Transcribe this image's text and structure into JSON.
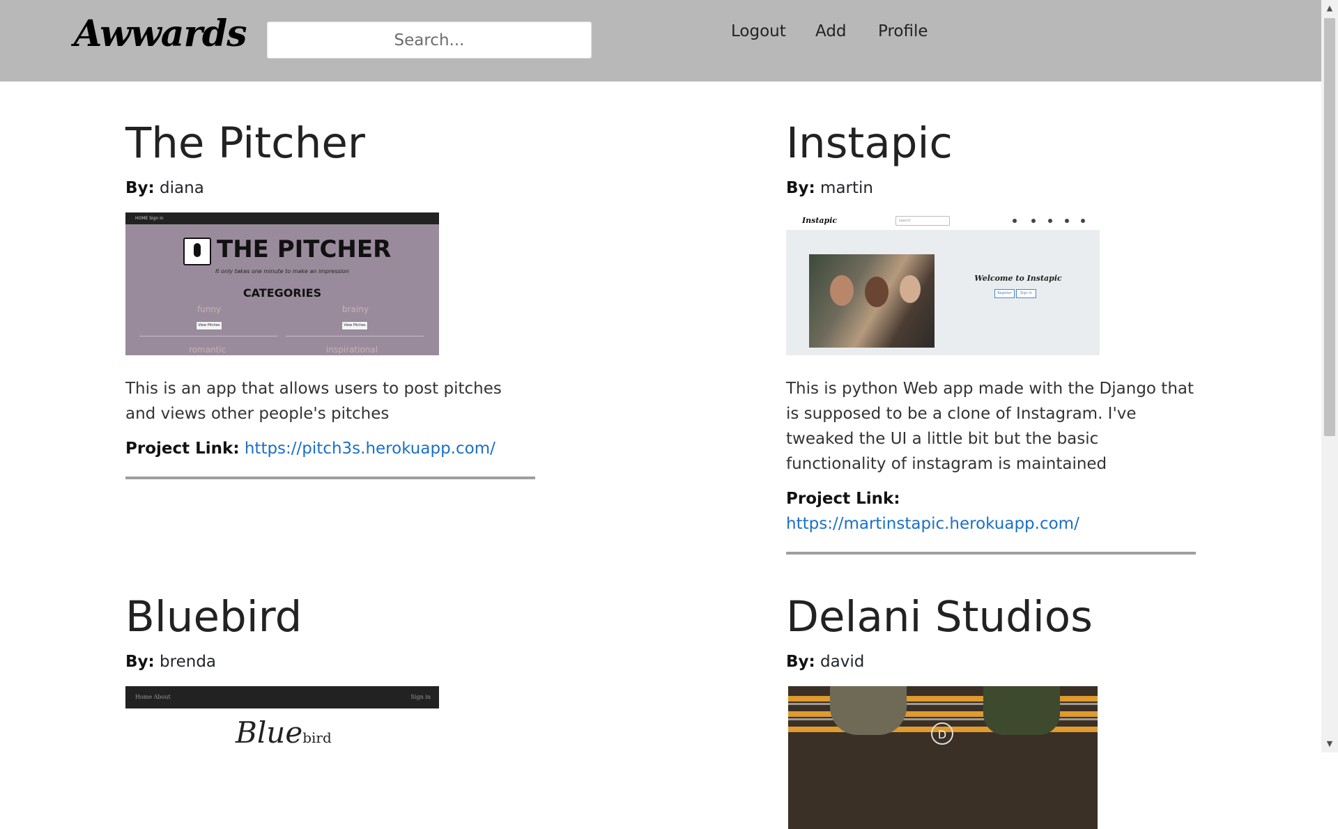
{
  "navbar": {
    "brand": "Awwards",
    "search_placeholder": "Search...",
    "links": [
      "Logout",
      "Add",
      "Profile"
    ]
  },
  "labels": {
    "by": "By:",
    "project_link": "Project Link:"
  },
  "projects": [
    {
      "title": "The Pitcher",
      "author": "diana",
      "description": "This is an app that allows users to post pitches and views other people's pitches",
      "link": "https://pitch3s.herokuapp.com/",
      "screenshot": {
        "nav": "HOME   Sign in",
        "logo": "THE PITCHER",
        "tagline": "It only takes one minute to make an impression",
        "heading": "CATEGORIES",
        "categories": [
          "funny",
          "brainy",
          "romantic",
          "inspirational"
        ],
        "button": "View Pitches"
      }
    },
    {
      "title": "Instapic",
      "author": "martin",
      "description": "This is python Web app made with the Django that is supposed to be a clone of Instagram. I've tweaked the UI a little bit but the basic functionality of instagram is maintained",
      "link": "https://martinstapic.herokuapp.com/",
      "screenshot": {
        "logo": "Instapic",
        "search": "search",
        "welcome": "Welcome to Instapic",
        "buttons": [
          "Register",
          "Sign In"
        ]
      }
    },
    {
      "title": "Bluebird",
      "author": "brenda",
      "screenshot": {
        "nav_left": "Home   About",
        "nav_right": "Sign in",
        "logo_script": "Blue",
        "logo_small": "bird"
      }
    },
    {
      "title": "Delani Studios",
      "author": "david",
      "screenshot": {
        "logo": "D"
      }
    }
  ]
}
